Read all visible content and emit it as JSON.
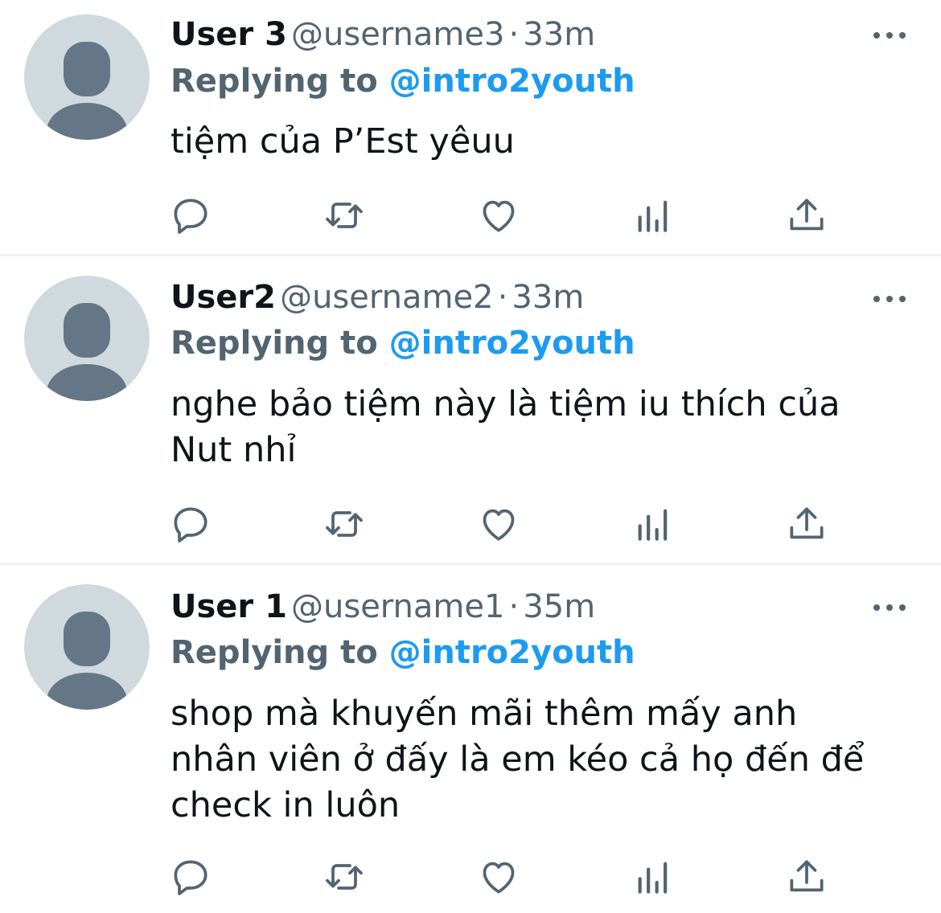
{
  "tweets": [
    {
      "name": "User 3",
      "handle": "@username3",
      "sep": "·",
      "time": "33m",
      "replying_label": "Replying to",
      "replying_handle": "@intro2youth",
      "text": "tiệm của P’Est yêuu"
    },
    {
      "name": "User2",
      "handle": "@username2",
      "sep": "·",
      "time": "33m",
      "replying_label": "Replying to",
      "replying_handle": "@intro2youth",
      "text_lines": [
        "nghe bảo tiệm này là tiệm iu thích của",
        "Nut nhỉ"
      ]
    },
    {
      "name": "User 1",
      "handle": "@username1",
      "sep": "·",
      "time": "35m",
      "replying_label": "Replying to",
      "replying_handle": "@intro2youth",
      "text_lines": [
        "shop mà khuyến mãi thêm mấy anh",
        "nhân viên ở đấy là em kéo cả họ đến để",
        "check in luôn"
      ]
    }
  ],
  "icons": [
    "avatar-icon",
    "more-icon",
    "reply-icon",
    "retweet-icon",
    "like-icon",
    "analytics-icon",
    "share-icon"
  ],
  "colors": {
    "link": "#1d9bf0",
    "secondary": "#536471",
    "icon": "#536471",
    "divider": "#eff3f4"
  }
}
